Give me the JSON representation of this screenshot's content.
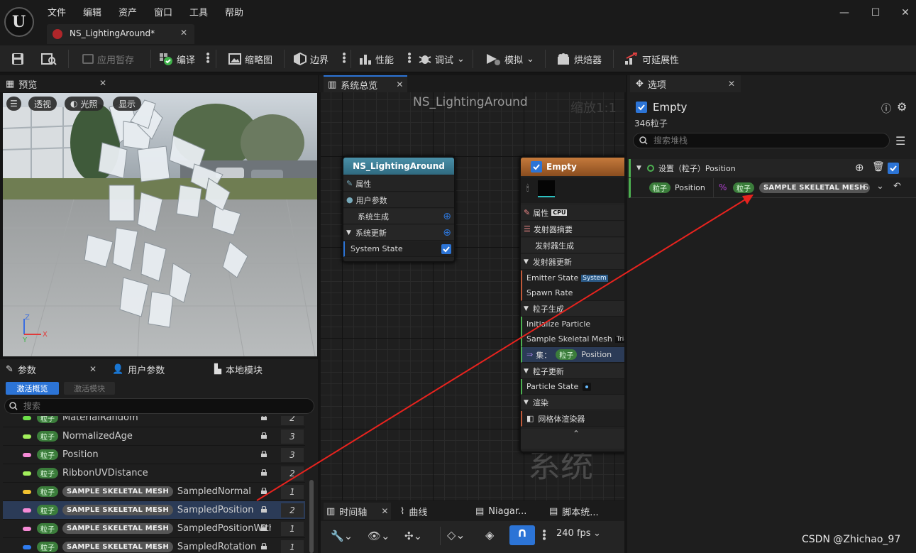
{
  "menu": [
    "文件",
    "编辑",
    "资产",
    "窗口",
    "工具",
    "帮助"
  ],
  "doc_tab": "NS_LightingAround*",
  "toolbar": {
    "apply_label": "应用暂存",
    "compile_label": "编译",
    "thumbnail_label": "缩略图",
    "bounds_label": "边界",
    "perf_label": "性能",
    "debug_label": "调试",
    "simulate_label": "模拟",
    "baker_label": "烘焙器",
    "scalability_label": "可延展性"
  },
  "preview": {
    "tab": "预览",
    "perspective": "透视",
    "lighting": "光照",
    "show": "显示",
    "axis_z": "Z",
    "axis_x": "X",
    "axis_y": "Y"
  },
  "params": {
    "tabs": [
      "参数",
      "用户参数",
      "本地模块"
    ],
    "filter_active": "激活概览",
    "filter_modules": "激活模块",
    "search_placeholder": "搜索",
    "rows": [
      {
        "color": "#6ee04a",
        "ns": "粒子",
        "mesh": "",
        "name": "MaterialRandom",
        "count": "2"
      },
      {
        "color": "#a3f05c",
        "ns": "粒子",
        "mesh": "",
        "name": "NormalizedAge",
        "count": "3"
      },
      {
        "color": "#f58ad6",
        "ns": "粒子",
        "mesh": "",
        "name": "Position",
        "count": "3"
      },
      {
        "color": "#a3f05c",
        "ns": "粒子",
        "mesh": "",
        "name": "RibbonUVDistance",
        "count": "2"
      },
      {
        "color": "#f2c230",
        "ns": "粒子",
        "mesh": "SAMPLE SKELETAL MESH",
        "name": "SampledNormal",
        "count": "1"
      },
      {
        "color": "#f58ad6",
        "ns": "粒子",
        "mesh": "SAMPLE SKELETAL MESH",
        "name": "SampledPosition",
        "count": "2"
      },
      {
        "color": "#f58ad6",
        "ns": "粒子",
        "mesh": "SAMPLE SKELETAL MESH",
        "name": "SampledPositionWitho",
        "count": "1"
      },
      {
        "color": "#2f7cf0",
        "ns": "粒子",
        "mesh": "SAMPLE SKELETAL MESH",
        "name": "SampledRotation",
        "count": "1"
      }
    ]
  },
  "graph": {
    "tab": "系统总览",
    "title": "NS_LightingAround",
    "zoom": "缩放1:1",
    "watermark": "系统",
    "system_node": {
      "title": "NS_LightingAround",
      "rows": [
        "属性",
        "用户参数",
        "系统生成",
        "系统更新",
        "System State"
      ]
    },
    "emitter_node": {
      "title": "Empty",
      "cpu": "CPU",
      "properties": "属性",
      "summary": "发射器摘要",
      "emitter_spawn": "发射器生成",
      "emitter_update": "发射器更新",
      "emitter_state": "Emitter State",
      "system_badge": "System",
      "spawn_rate": "Spawn Rate",
      "particle_spawn": "粒子生成",
      "init_particle": "Initialize Particle",
      "sample_mesh": "Sample Skeletal Mesh",
      "sample_mesh_suffix": "Trian",
      "set_label": "集：",
      "set_ns": "粒子",
      "set_name": "Position",
      "particle_update": "粒子更新",
      "particle_state": "Particle State",
      "render": "渲染",
      "mesh_renderer": "网格体渲染器"
    }
  },
  "bottom_tabs": [
    "时间轴",
    "曲线",
    "Niagar...",
    "脚本统..."
  ],
  "fps": "240 fps",
  "selection": {
    "tab": "选项",
    "emitter": "Empty",
    "count": "346粒子",
    "search_placeholder": "搜索堆栈",
    "module_title": "设置（粒子）Position",
    "param_ns": "粒子",
    "param_name": "Position",
    "link_ns": "粒子",
    "link_mesh": "SAMPLE SKELETAL MESH",
    "link_suffix": "S"
  },
  "watermark_text": "CSDN @Zhichao_97",
  "colors": {
    "accent": "#2c74d6",
    "arrow": "#e8231e",
    "particle_pill": "#3b7d3b"
  }
}
